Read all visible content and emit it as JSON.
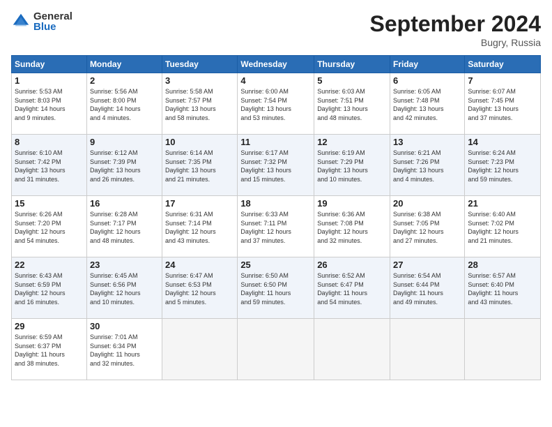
{
  "header": {
    "logo_general": "General",
    "logo_blue": "Blue",
    "month_title": "September 2024",
    "location": "Bugry, Russia"
  },
  "weekdays": [
    "Sunday",
    "Monday",
    "Tuesday",
    "Wednesday",
    "Thursday",
    "Friday",
    "Saturday"
  ],
  "weeks": [
    [
      {
        "day": "1",
        "sunrise": "5:53 AM",
        "sunset": "8:03 PM",
        "daylight": "14 hours and 9 minutes."
      },
      {
        "day": "2",
        "sunrise": "5:56 AM",
        "sunset": "8:00 PM",
        "daylight": "14 hours and 4 minutes."
      },
      {
        "day": "3",
        "sunrise": "5:58 AM",
        "sunset": "7:57 PM",
        "daylight": "13 hours and 58 minutes."
      },
      {
        "day": "4",
        "sunrise": "6:00 AM",
        "sunset": "7:54 PM",
        "daylight": "13 hours and 53 minutes."
      },
      {
        "day": "5",
        "sunrise": "6:03 AM",
        "sunset": "7:51 PM",
        "daylight": "13 hours and 48 minutes."
      },
      {
        "day": "6",
        "sunrise": "6:05 AM",
        "sunset": "7:48 PM",
        "daylight": "13 hours and 42 minutes."
      },
      {
        "day": "7",
        "sunrise": "6:07 AM",
        "sunset": "7:45 PM",
        "daylight": "13 hours and 37 minutes."
      }
    ],
    [
      {
        "day": "8",
        "sunrise": "6:10 AM",
        "sunset": "7:42 PM",
        "daylight": "13 hours and 31 minutes."
      },
      {
        "day": "9",
        "sunrise": "6:12 AM",
        "sunset": "7:39 PM",
        "daylight": "13 hours and 26 minutes."
      },
      {
        "day": "10",
        "sunrise": "6:14 AM",
        "sunset": "7:35 PM",
        "daylight": "13 hours and 21 minutes."
      },
      {
        "day": "11",
        "sunrise": "6:17 AM",
        "sunset": "7:32 PM",
        "daylight": "13 hours and 15 minutes."
      },
      {
        "day": "12",
        "sunrise": "6:19 AM",
        "sunset": "7:29 PM",
        "daylight": "13 hours and 10 minutes."
      },
      {
        "day": "13",
        "sunrise": "6:21 AM",
        "sunset": "7:26 PM",
        "daylight": "13 hours and 4 minutes."
      },
      {
        "day": "14",
        "sunrise": "6:24 AM",
        "sunset": "7:23 PM",
        "daylight": "12 hours and 59 minutes."
      }
    ],
    [
      {
        "day": "15",
        "sunrise": "6:26 AM",
        "sunset": "7:20 PM",
        "daylight": "12 hours and 54 minutes."
      },
      {
        "day": "16",
        "sunrise": "6:28 AM",
        "sunset": "7:17 PM",
        "daylight": "12 hours and 48 minutes."
      },
      {
        "day": "17",
        "sunrise": "6:31 AM",
        "sunset": "7:14 PM",
        "daylight": "12 hours and 43 minutes."
      },
      {
        "day": "18",
        "sunrise": "6:33 AM",
        "sunset": "7:11 PM",
        "daylight": "12 hours and 37 minutes."
      },
      {
        "day": "19",
        "sunrise": "6:36 AM",
        "sunset": "7:08 PM",
        "daylight": "12 hours and 32 minutes."
      },
      {
        "day": "20",
        "sunrise": "6:38 AM",
        "sunset": "7:05 PM",
        "daylight": "12 hours and 27 minutes."
      },
      {
        "day": "21",
        "sunrise": "6:40 AM",
        "sunset": "7:02 PM",
        "daylight": "12 hours and 21 minutes."
      }
    ],
    [
      {
        "day": "22",
        "sunrise": "6:43 AM",
        "sunset": "6:59 PM",
        "daylight": "12 hours and 16 minutes."
      },
      {
        "day": "23",
        "sunrise": "6:45 AM",
        "sunset": "6:56 PM",
        "daylight": "12 hours and 10 minutes."
      },
      {
        "day": "24",
        "sunrise": "6:47 AM",
        "sunset": "6:53 PM",
        "daylight": "12 hours and 5 minutes."
      },
      {
        "day": "25",
        "sunrise": "6:50 AM",
        "sunset": "6:50 PM",
        "daylight": "11 hours and 59 minutes."
      },
      {
        "day": "26",
        "sunrise": "6:52 AM",
        "sunset": "6:47 PM",
        "daylight": "11 hours and 54 minutes."
      },
      {
        "day": "27",
        "sunrise": "6:54 AM",
        "sunset": "6:44 PM",
        "daylight": "11 hours and 49 minutes."
      },
      {
        "day": "28",
        "sunrise": "6:57 AM",
        "sunset": "6:40 PM",
        "daylight": "11 hours and 43 minutes."
      }
    ],
    [
      {
        "day": "29",
        "sunrise": "6:59 AM",
        "sunset": "6:37 PM",
        "daylight": "11 hours and 38 minutes."
      },
      {
        "day": "30",
        "sunrise": "7:01 AM",
        "sunset": "6:34 PM",
        "daylight": "11 hours and 32 minutes."
      },
      null,
      null,
      null,
      null,
      null
    ]
  ]
}
